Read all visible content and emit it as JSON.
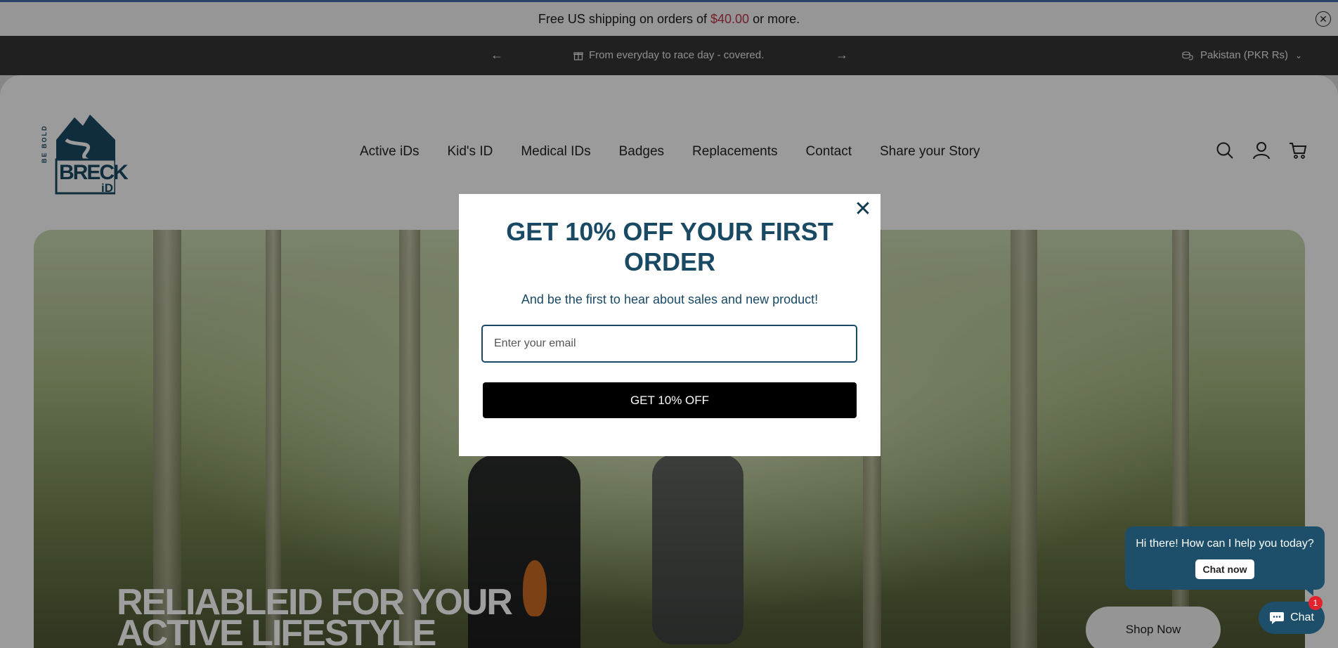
{
  "announcement": {
    "text_before": "Free US shipping on orders of",
    "price": "$40.00",
    "text_after": "or more.",
    "close_icon": "close-circle-icon"
  },
  "promo_bar": {
    "message": "From everyday to race day - covered.",
    "region": "Pakistan (PKR Rs)",
    "prev_icon": "arrow-left-icon",
    "next_icon": "arrow-right-icon"
  },
  "header": {
    "logo": {
      "top_text": "BE BOLD",
      "main": "BRECK",
      "suffix": "iD"
    },
    "nav": [
      "Active iDs",
      "Kid's ID",
      "Medical IDs",
      "Badges",
      "Replacements",
      "Contact",
      "Share your Story"
    ],
    "icons": [
      "search-icon",
      "account-icon",
      "cart-icon"
    ]
  },
  "hero": {
    "title_line1": "RELIABLEID FOR YOUR",
    "title_line2": "ACTIVE LIFESTYLE",
    "cta": "Shop Now"
  },
  "modal": {
    "title": "GET 10% OFF YOUR FIRST ORDER",
    "subtitle": "And be the first to hear about sales and new product!",
    "email_placeholder": "Enter your email",
    "submit": "GET 10% OFF"
  },
  "chat": {
    "greeting": "Hi there! How can I help you today?",
    "chat_now": "Chat now",
    "launcher": "Chat",
    "badge": "1"
  },
  "colors": {
    "brand_navy": "#1a4964",
    "price_red": "#b8334a",
    "chat_teal": "#1d4f6a"
  }
}
